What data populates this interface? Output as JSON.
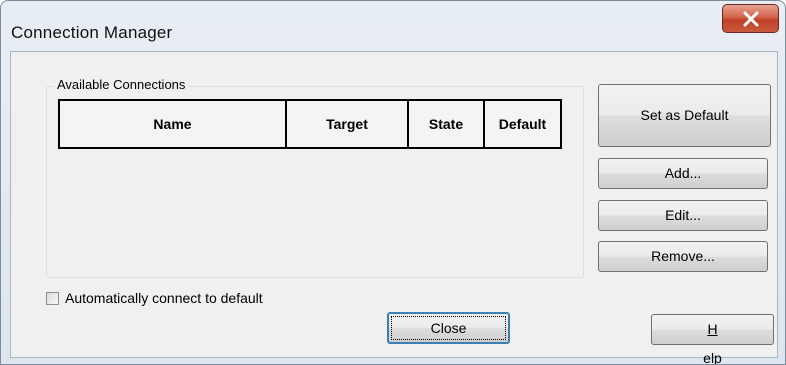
{
  "window": {
    "title": "Connection Manager"
  },
  "group": {
    "legend": "Available Connections",
    "columns": [
      "Name",
      "Target",
      "State",
      "Default"
    ]
  },
  "buttons": {
    "set_default": "Set as Default",
    "add": "Add...",
    "edit": "Edit...",
    "remove": "Remove...",
    "close": "Close",
    "help_accel": "H",
    "help_rest": "elp"
  },
  "options": {
    "auto_connect_label": "Automatically connect to default",
    "auto_connect_checked": false
  },
  "icons": {
    "window_close": "close-icon"
  },
  "colors": {
    "close_button": "#c95a3f",
    "focus_border": "#3c7fb1"
  }
}
